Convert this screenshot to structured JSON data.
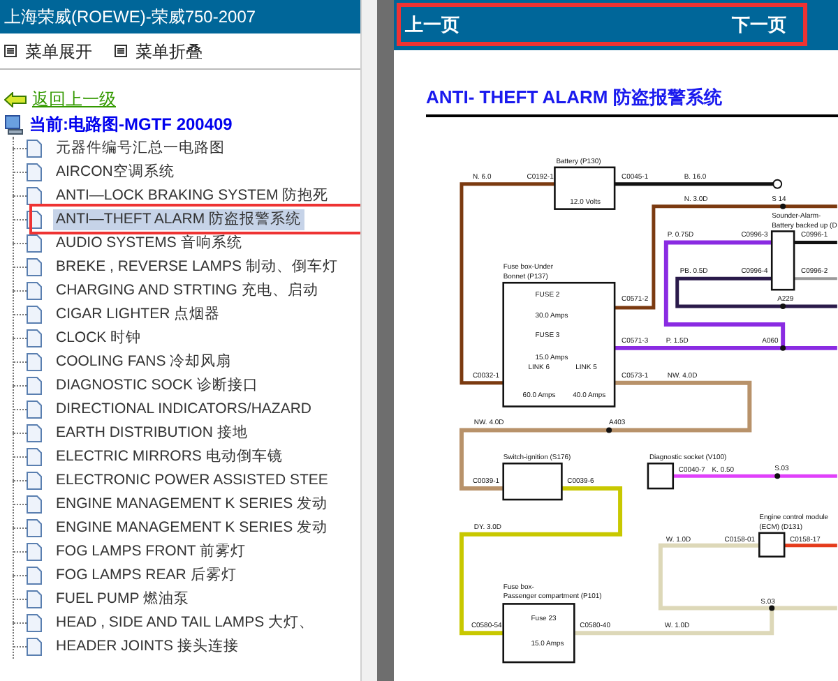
{
  "sidebar": {
    "title": "上海荣威(ROEWE)-荣威750-2007",
    "menu": [
      "菜单展开",
      "菜单折叠"
    ],
    "back_link": "返回上一级",
    "root": "当前:电路图-MGTF 200409",
    "items": [
      {
        "label": "元器件编号汇总一电路图",
        "selected": false
      },
      {
        "label": "AIRCON空调系统",
        "selected": false
      },
      {
        "label": "ANTI—LOCK BRAKING SYSTEM 防抱死",
        "selected": false
      },
      {
        "label": "ANTI—THEFT ALARM 防盗报警系统",
        "selected": true
      },
      {
        "label": "AUDIO SYSTEMS 音响系统",
        "selected": false
      },
      {
        "label": "BREKE , REVERSE LAMPS 制动、倒车灯",
        "selected": false
      },
      {
        "label": "CHARGING AND STRTING 充电、启动",
        "selected": false
      },
      {
        "label": "CIGAR LIGHTER 点烟器",
        "selected": false
      },
      {
        "label": "CLOCK 时钟",
        "selected": false
      },
      {
        "label": "COOLING FANS 冷却风扇",
        "selected": false
      },
      {
        "label": "DIAGNOSTIC SOCK 诊断接口",
        "selected": false
      },
      {
        "label": "DIRECTIONAL INDICATORS/HAZARD",
        "selected": false
      },
      {
        "label": "EARTH DISTRIBUTION 接地",
        "selected": false
      },
      {
        "label": "ELECTRIC MIRRORS 电动倒车镜",
        "selected": false
      },
      {
        "label": "ELECTRONIC POWER ASSISTED STEE",
        "selected": false
      },
      {
        "label": "ENGINE MANAGEMENT K SERIES 发动",
        "selected": false
      },
      {
        "label": "ENGINE MANAGEMENT K SERIES 发动",
        "selected": false
      },
      {
        "label": "FOG LAMPS FRONT 前雾灯",
        "selected": false
      },
      {
        "label": "FOG LAMPS REAR 后雾灯",
        "selected": false
      },
      {
        "label": "FUEL PUMP 燃油泵",
        "selected": false
      },
      {
        "label": "HEAD , SIDE AND TAIL LAMPS 大灯、",
        "selected": false
      },
      {
        "label": "HEADER JOINTS 接头连接",
        "selected": false
      }
    ]
  },
  "nav": {
    "prev": "上一页",
    "next": "下一页"
  },
  "document": {
    "title": "ANTI- THEFT ALARM 防盗报警系统",
    "diagram_labels": [
      "Battery (P130)",
      "12.0 Volts",
      "N. 6.0",
      "C0192-1",
      "C0045-1",
      "B. 16.0",
      "N. 3.0D",
      "S 14",
      "Sounder-Alarm-",
      "Battery backed up (D",
      "P. 0.75D",
      "C0996-3",
      "C0996-1",
      "PB. 0.5D",
      "C0996-4",
      "C0996-2",
      "Fuse box-Under",
      "Bonnet (P137)",
      "A229",
      "FUSE 2",
      "C0571-2",
      "30.0 Amps",
      "FUSE 3",
      "C0571-3",
      "P. 1.5D",
      "A060",
      "15.0 Amps",
      "C0032-1",
      "LINK 6",
      "LINK 5",
      "C0573-1",
      "NW. 4.0D",
      "60.0 Amps",
      "40.0 Amps",
      "NW. 4.0D",
      "A403",
      "Switch-ignition (S176)",
      "C0039-1",
      "C0039-6",
      "Diagnostic socket (V100)",
      "C0040-7",
      "K. 0.50",
      "S.03",
      "DY. 3.0D",
      "Engine control module",
      "(ECM) (D131)",
      "W. 1.0D",
      "C0158-01",
      "C0158-17",
      "S.03",
      "Fuse box-",
      "Passenger compartment (P101)",
      "C0580-54",
      "Fuse 23",
      "C0580-40",
      "W. 1.0D",
      "15.0 Amps"
    ]
  }
}
